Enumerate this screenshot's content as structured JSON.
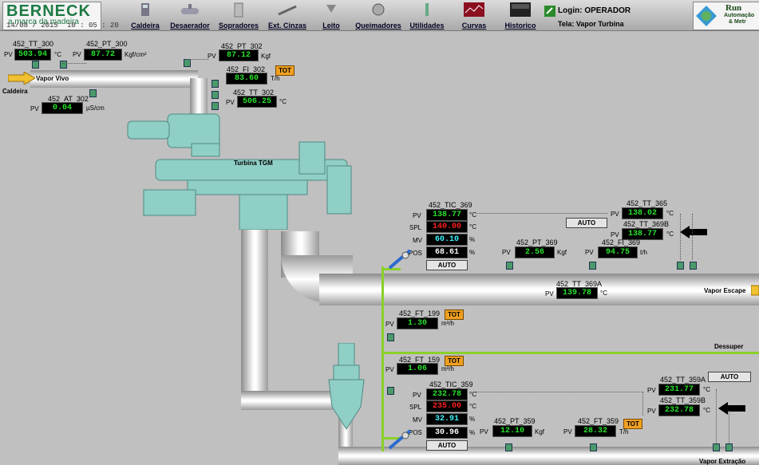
{
  "header": {
    "logo_title": "BERNECK",
    "logo_subtitle": "a marca da madeira",
    "date": "14/08 / 2015",
    "time": "10 : 05 : 20",
    "nav": [
      {
        "label": "Caldeira",
        "icon": "boiler-icon"
      },
      {
        "label": "Desaerador",
        "icon": "deaerator-icon"
      },
      {
        "label": "Sopradores",
        "icon": "blower-icon"
      },
      {
        "label": "Ext. Cinzas",
        "icon": "ash-extractor-icon"
      },
      {
        "label": "Leito",
        "icon": "bed-icon"
      },
      {
        "label": "Queimadores",
        "icon": "burner-icon"
      },
      {
        "label": "Utilidades",
        "icon": "utilities-icon"
      },
      {
        "label": "Curvas",
        "icon": "trend-curves-icon"
      },
      {
        "label": "Historico",
        "icon": "history-icon"
      }
    ],
    "login": "Login: OPERADOR",
    "tela": "Tela: Vapor Turbina",
    "run_logo": "Run",
    "run_sub1": "Automação",
    "run_sub2": "& Metr"
  },
  "colors": {
    "value_green": "#27e22a",
    "value_red": "#ff2020",
    "value_cyan": "#3cf5ff",
    "tot": "#f0a020"
  },
  "labels": {
    "vapor_vivo": "Vapor Vivo",
    "caldeira": "Caldeira",
    "turbina": "Turbina TGM",
    "vapor_escape": "Vapor Escape",
    "dessuper": "Dessuper",
    "vapor_extracao": "Vapor Extração"
  },
  "common": {
    "pv": "PV",
    "spl": "SPL",
    "mv": "MV",
    "pos": "POS",
    "auto": "AUTO",
    "tot": "TOT"
  },
  "inst": {
    "tt300": {
      "tag": "452_TT_300",
      "value": "503.94",
      "unit": "°C"
    },
    "pt300": {
      "tag": "452_PT_300",
      "value": "87.72",
      "unit": "Kgf/cm²"
    },
    "pt302": {
      "tag": "452_PT_302",
      "value": "87.12",
      "unit": "Kgf"
    },
    "fi302": {
      "tag": "452_FI_302",
      "value": "83.60",
      "unit": "T/h"
    },
    "tt302": {
      "tag": "452_TT_302",
      "value": "506.25",
      "unit": "°C"
    },
    "at302": {
      "tag": "452_AT_302",
      "value": "0.04",
      "unit": "µS/cm"
    },
    "tic369": {
      "tag": "452_TIC_369",
      "pv": "138.77",
      "spl": "140.00",
      "mv": "60.10",
      "pos": "68.61",
      "unit": "°C",
      "pct": "%"
    },
    "tt365": {
      "tag": "452_TT_365",
      "value": "138.02",
      "unit": "°C"
    },
    "tt369b": {
      "tag": "452_TT_369B",
      "value": "138.77",
      "unit": "°C"
    },
    "pt369": {
      "tag": "452_PT_369",
      "value": "2.56",
      "unit": "Kgf"
    },
    "fi369": {
      "tag": "452_FI_369",
      "value": "94.75",
      "unit": "t/h"
    },
    "tt369a": {
      "tag": "452_TT_369A",
      "value": "139.78",
      "unit": "°C"
    },
    "ft199": {
      "tag": "452_FT_199",
      "value": "1.30",
      "unit": "m³/h"
    },
    "ft159": {
      "tag": "452_FT_159",
      "value": "1.06",
      "unit": "m³/h"
    },
    "tic359": {
      "tag": "452_TIC_359",
      "pv": "232.78",
      "spl": "235.00",
      "mv": "32.91",
      "pos": "30.96",
      "unit": "°C",
      "pct": "%"
    },
    "tt359a": {
      "tag": "452_TT_359A",
      "value": "231.77",
      "unit": "°C"
    },
    "tt359b": {
      "tag": "452_TT_359B",
      "value": "232.78",
      "unit": "°C"
    },
    "pt359": {
      "tag": "452_PT_359",
      "value": "12.10",
      "unit": "Kgf"
    },
    "ft359": {
      "tag": "452_FT_359",
      "value": "28.32",
      "unit": "T/h"
    }
  }
}
